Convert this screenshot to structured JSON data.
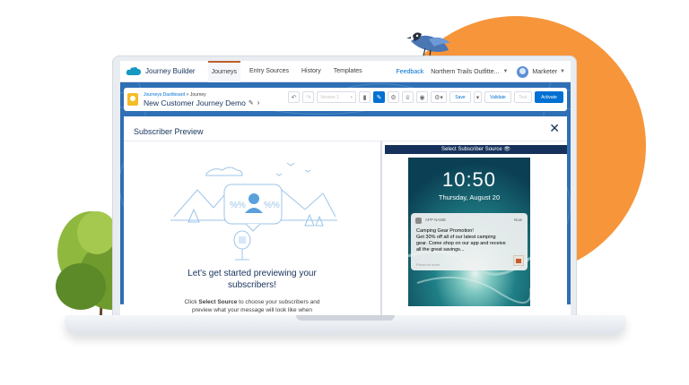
{
  "app": {
    "name": "Journey Builder",
    "tabs": [
      {
        "label": "Journeys",
        "active": true
      },
      {
        "label": "Entry Sources",
        "active": false
      },
      {
        "label": "History",
        "active": false
      },
      {
        "label": "Templates",
        "active": false
      }
    ],
    "feedback": "Feedback",
    "org": "Northern Trails Outfitte...",
    "user_role": "Marketer"
  },
  "builder": {
    "breadcrumb_root": "Journeys Dashboard",
    "breadcrumb_sep": " > ",
    "breadcrumb_current": "Journey",
    "journey_name": "New Customer Journey Demo",
    "version": "Version 1",
    "save": "Save",
    "validate": "Validate",
    "test": "Test",
    "activate": "Activate"
  },
  "modal": {
    "title": "Subscriber Preview",
    "heading": "Let's get started previewing your subscribers!",
    "body_prefix": "Click ",
    "body_bold": "Select Source",
    "body_suffix": " to choose your subscribers and preview what your message will look like when"
  },
  "preview": {
    "source_bar": "Select Subscriber Source",
    "time": "10:50",
    "date": "Thursday, August 20",
    "notification": {
      "app": "APP NAME",
      "when": "Now",
      "title": "Camping Gear Promotion!",
      "body": "Get 30% off all of our latest camping gear. Come shop on our app and receive all the great savings...",
      "hint": "Press for more"
    }
  },
  "colors": {
    "accent_orange": "#f7953b",
    "brand_blue": "#0070d2",
    "band_blue": "#2e6fb5",
    "navy": "#16325c"
  }
}
